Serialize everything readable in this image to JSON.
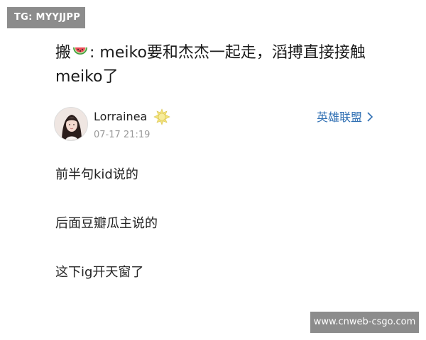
{
  "watermarks": {
    "top_left": "TG: MYYJJPP",
    "bottom_right": "www.cnweb-csgo.com"
  },
  "post": {
    "title_prefix": "搬",
    "title_icon": "watermelon-icon",
    "title_text": ": meiko要和杰杰一起走，滔搏直接接触meiko了",
    "author": {
      "name": "Lorrainea",
      "badge_icon": "sun-badge-icon",
      "avatar_icon": "avatar-photo",
      "time": "07-17 21:19"
    },
    "topic": {
      "label": "英雄联盟",
      "icon": "chevron-right-icon",
      "color": "#2f6fb3"
    },
    "lines": [
      "前半句kid说的",
      "后面豆瓣瓜主说的",
      "这下ig开天窗了"
    ]
  }
}
